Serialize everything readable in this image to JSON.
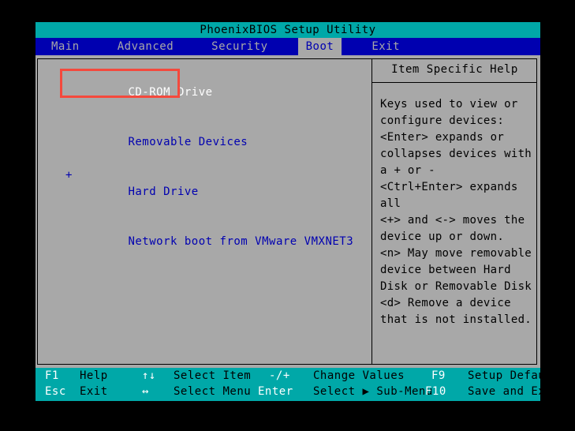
{
  "window": {
    "title": "PhoenixBIOS Setup Utility"
  },
  "menubar": {
    "items": [
      {
        "label": "Main",
        "active": false
      },
      {
        "label": "Advanced",
        "active": false
      },
      {
        "label": "Security",
        "active": false
      },
      {
        "label": "Boot",
        "active": true
      },
      {
        "label": "Exit",
        "active": false
      }
    ]
  },
  "boot_order": {
    "items": [
      {
        "prefix": "",
        "label": "CD-ROM Drive",
        "selected": true
      },
      {
        "prefix": "",
        "label": "Removable Devices",
        "selected": false
      },
      {
        "prefix": "+",
        "label": "Hard Drive",
        "selected": false
      },
      {
        "prefix": "",
        "label": "Network boot from VMware VMXNET3",
        "selected": false
      }
    ]
  },
  "help": {
    "title": "Item Specific Help",
    "lines": [
      "Keys used to view or",
      "configure devices:",
      "<Enter> expands or",
      "collapses devices with",
      "a + or -",
      "<Ctrl+Enter> expands",
      "all",
      "<+> and <-> moves the",
      "device up or down.",
      "<n> May move removable",
      "device between Hard",
      "Disk or Removable Disk",
      "<d> Remove a device",
      "that is not installed."
    ]
  },
  "footer": {
    "row1": [
      {
        "key": "F1",
        "desc": "Help"
      },
      {
        "key": "↑↓",
        "desc": "Select Item"
      },
      {
        "key": "-/+",
        "desc": "Change Values"
      },
      {
        "key": "F9",
        "desc": "Setup Defaults"
      }
    ],
    "row2": [
      {
        "key": "Esc",
        "desc": "Exit"
      },
      {
        "key": "↔",
        "desc": "Select Menu"
      },
      {
        "key": "Enter",
        "desc": "Select ▶ Sub-Menu"
      },
      {
        "key": "F10",
        "desc": "Save and Exit"
      }
    ]
  },
  "annotation": {
    "target": "CD-ROM Drive",
    "color": "#f4493d"
  },
  "colors": {
    "title_bar": "#00a8a8",
    "menu_bar": "#0000b0",
    "panel_bg": "#a8a8a8",
    "text_blue": "#0000b0",
    "text_selected": "#ffffff",
    "footer_bg": "#00a8a8",
    "letterbox": "#000000"
  }
}
